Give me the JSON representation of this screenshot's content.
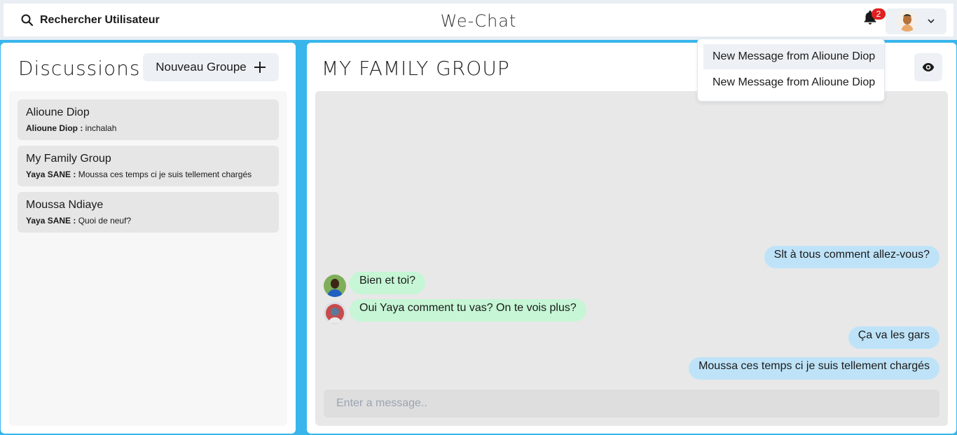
{
  "header": {
    "search_label": "Rechercher Utilisateur",
    "app_title": "We-Chat",
    "notification_count": "2",
    "icons": {
      "search": "search-icon",
      "bell": "bell-icon",
      "chevron": "chevron-down-icon"
    }
  },
  "notifications": [
    {
      "text": "New Message from Alioune Diop"
    },
    {
      "text": "New Message from Alioune Diop"
    }
  ],
  "sidebar": {
    "title": "Discussions",
    "new_group_label": "Nouveau Groupe",
    "chats": [
      {
        "name": "Alioune Diop",
        "sender": "Alioune Diop :",
        "preview": "inchalah"
      },
      {
        "name": "My Family Group",
        "sender": "Yaya SANE :",
        "preview": "Moussa ces temps ci je suis tellement chargés"
      },
      {
        "name": "Moussa Ndiaye",
        "sender": "Yaya SANE :",
        "preview": "Quoi de neuf?"
      }
    ]
  },
  "chat": {
    "title": "MY FAMILY GROUP",
    "messages": [
      {
        "direction": "out",
        "text": "Slt à tous comment allez-vous?"
      },
      {
        "direction": "in",
        "text": "Bien et toi?"
      },
      {
        "direction": "in",
        "text": "Oui Yaya comment tu vas? On te vois plus?"
      },
      {
        "direction": "out",
        "text": "Ça va les gars"
      },
      {
        "direction": "out",
        "text": "Moussa ces temps ci je suis tellement chargés"
      }
    ],
    "input_placeholder": "Enter a message.."
  },
  "colors": {
    "accent": "#38b6ec",
    "outgoing_bubble": "#bee3f8",
    "incoming_bubble": "#c6f6d5",
    "badge": "#e02020"
  }
}
